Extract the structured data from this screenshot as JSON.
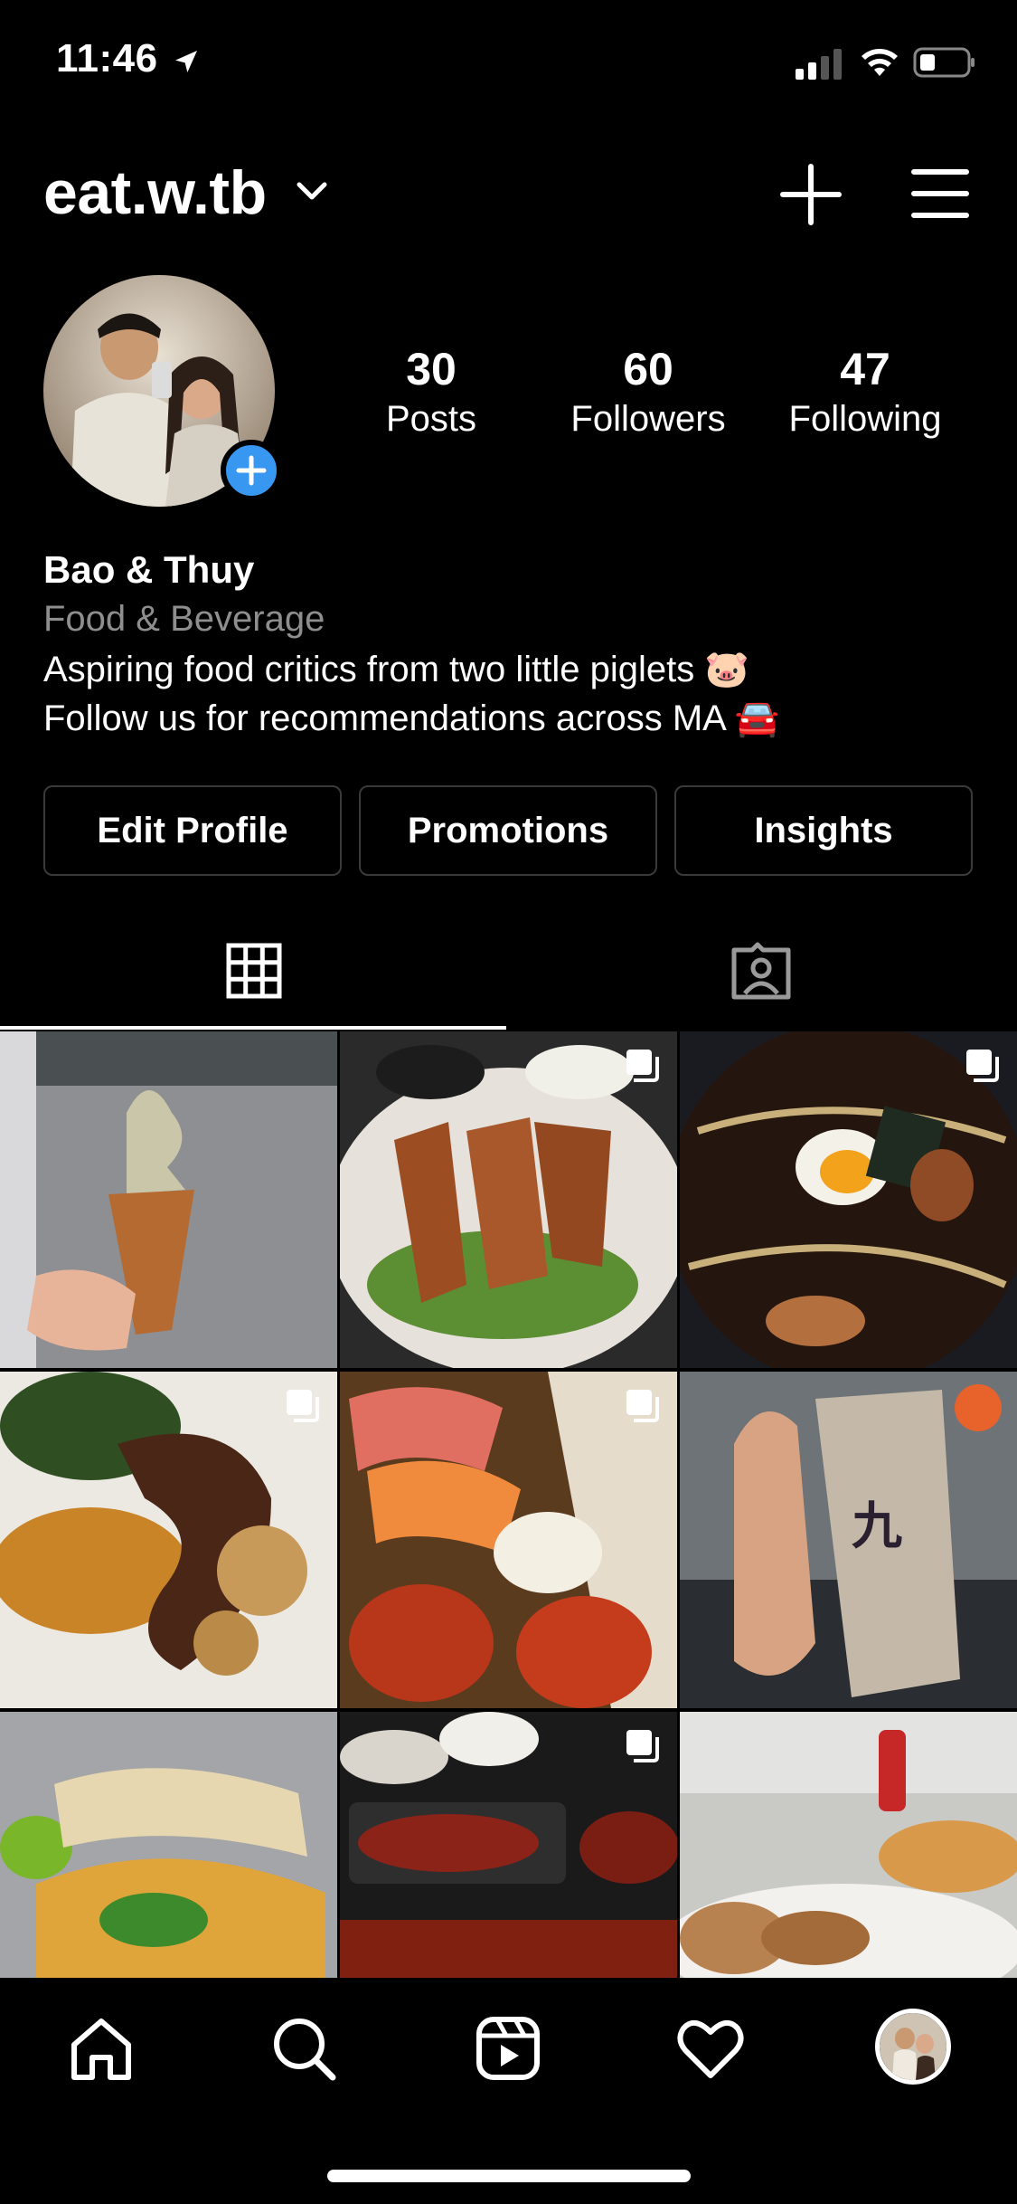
{
  "status_bar": {
    "time": "11:46"
  },
  "header": {
    "username": "eat.w.tb"
  },
  "profile": {
    "stats": [
      {
        "value": "30",
        "label": "Posts"
      },
      {
        "value": "60",
        "label": "Followers"
      },
      {
        "value": "47",
        "label": "Following"
      }
    ],
    "display_name": "Bao & Thuy",
    "category": "Food & Beverage",
    "bio_line1": "Aspiring food critics from two little piglets 🐷",
    "bio_line2": "Follow us for recommendations across MA 🚘"
  },
  "buttons": {
    "edit_profile": "Edit Profile",
    "promotions": "Promotions",
    "insights": "Insights"
  },
  "icons": {
    "status": [
      "location-arrow-icon",
      "signal-icon",
      "wifi-icon",
      "battery-icon"
    ],
    "header": [
      "chevron-down-icon",
      "plus-icon",
      "menu-icon"
    ],
    "tabs": [
      "grid-icon",
      "tagged-icon"
    ],
    "nav": [
      "home-icon",
      "search-icon",
      "reels-icon",
      "heart-icon",
      "profile-avatar"
    ]
  },
  "colors": {
    "background": "#000000",
    "accent": "#3897f0",
    "secondary_text": "#8e8e8e"
  }
}
